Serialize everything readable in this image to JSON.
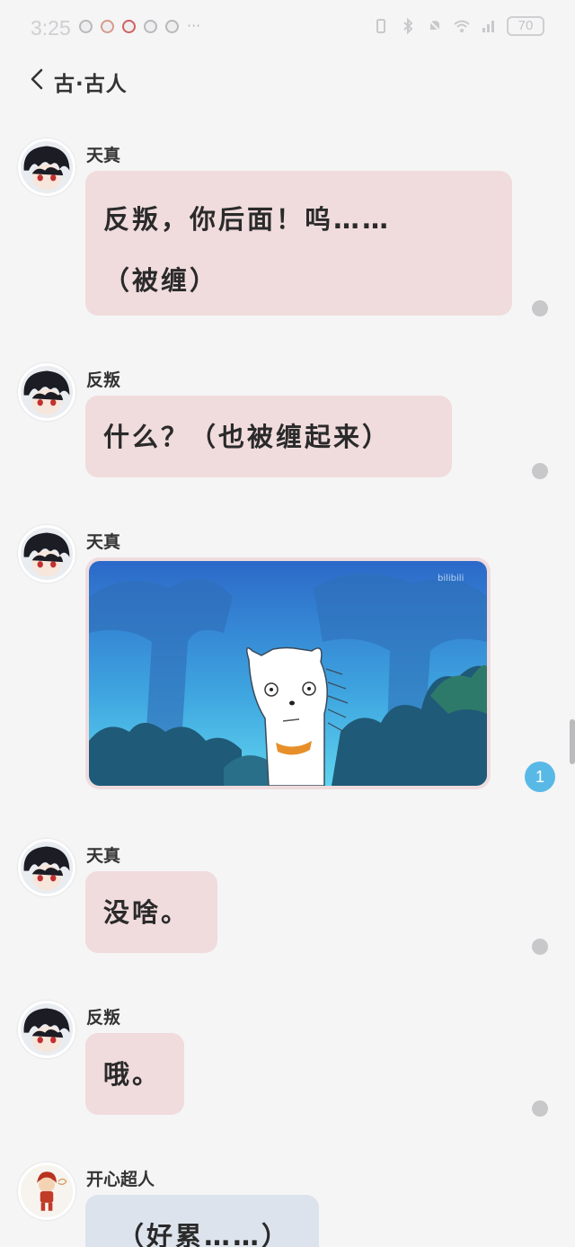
{
  "status_bar": {
    "time": "3:25",
    "more": "···",
    "battery": "70"
  },
  "header": {
    "title": "古·古人"
  },
  "messages": [
    {
      "sender": "天真",
      "lines": [
        "反叛，你后面！呜……",
        "（被缠）"
      ],
      "read": "dot"
    },
    {
      "sender": "反叛",
      "lines": [
        "什么？（也被缠起来）"
      ],
      "read": "dot"
    },
    {
      "sender": "天真",
      "type": "image",
      "image_watermark": "bilibili",
      "read_count": "1"
    },
    {
      "sender": "天真",
      "lines": [
        "没啥。"
      ],
      "read": "dot"
    },
    {
      "sender": "反叛",
      "lines": [
        "哦。"
      ],
      "read": "dot"
    },
    {
      "sender": "开心超人",
      "lines": [
        "（好累……）"
      ]
    }
  ],
  "colors": {
    "bubble_pink": "#f0dbdd",
    "bubble_blue": "#dde3ec",
    "read_badge": "#58b9e6",
    "background": "#f5f5f6"
  },
  "icons": [
    "back-chevron-icon",
    "wifi-icon",
    "bluetooth-icon",
    "mute-icon",
    "battery-icon"
  ]
}
